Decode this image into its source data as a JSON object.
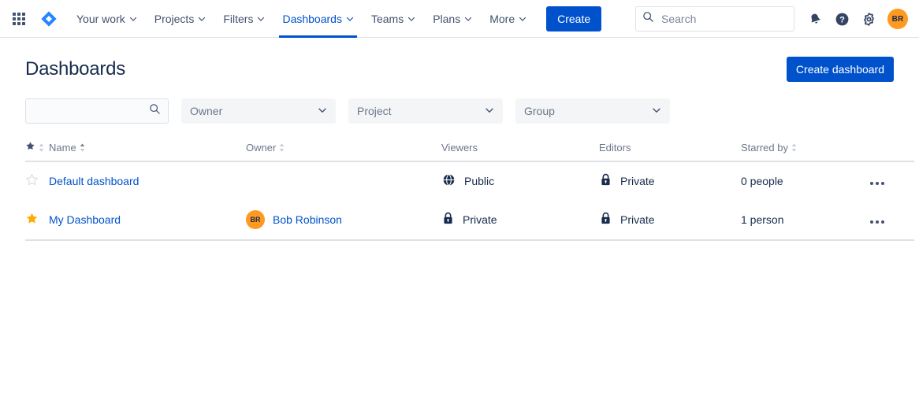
{
  "nav": {
    "app_switcher": "apps-grid-icon",
    "logo": "jira-logo-icon",
    "items": [
      {
        "label": "Your work",
        "has_chevron": true,
        "active": false
      },
      {
        "label": "Projects",
        "has_chevron": true,
        "active": false
      },
      {
        "label": "Filters",
        "has_chevron": true,
        "active": false
      },
      {
        "label": "Dashboards",
        "has_chevron": true,
        "active": true
      },
      {
        "label": "Teams",
        "has_chevron": true,
        "active": false
      },
      {
        "label": "Plans",
        "has_chevron": true,
        "active": false
      },
      {
        "label": "More",
        "has_chevron": true,
        "active": false
      }
    ],
    "create_label": "Create",
    "search": {
      "value": "",
      "placeholder": "Search"
    },
    "notifications_icon": "bell-icon",
    "help_icon": "help-icon",
    "settings_icon": "gear-icon",
    "avatar_initials": "BR"
  },
  "header": {
    "title": "Dashboards",
    "create_dashboard_label": "Create dashboard"
  },
  "filters": {
    "search": {
      "value": "",
      "placeholder": ""
    },
    "owner": {
      "label": "Owner"
    },
    "project": {
      "label": "Project"
    },
    "group": {
      "label": "Group"
    }
  },
  "table": {
    "columns": [
      {
        "key": "star",
        "label": "",
        "sortable": true
      },
      {
        "key": "name",
        "label": "Name",
        "sortable": true,
        "sort": "asc"
      },
      {
        "key": "owner",
        "label": "Owner",
        "sortable": true
      },
      {
        "key": "viewers",
        "label": "Viewers",
        "sortable": false
      },
      {
        "key": "editors",
        "label": "Editors",
        "sortable": false
      },
      {
        "key": "starred_by",
        "label": "Starred by",
        "sortable": true
      },
      {
        "key": "more",
        "label": "",
        "sortable": false
      }
    ],
    "rows": [
      {
        "starred": false,
        "name": "Default dashboard",
        "owner_name": "",
        "owner_initials": "",
        "viewers": "Public",
        "viewers_icon": "globe-icon",
        "editors": "Private",
        "editors_icon": "lock-icon",
        "starred_by": "0 people"
      },
      {
        "starred": true,
        "name": "My Dashboard",
        "owner_name": "Bob Robinson",
        "owner_initials": "BR",
        "viewers": "Private",
        "viewers_icon": "lock-icon",
        "editors": "Private",
        "editors_icon": "lock-icon",
        "starred_by": "1 person"
      }
    ]
  },
  "colors": {
    "brand_blue": "#0052CC",
    "link_blue": "#0052CC",
    "avatar_orange": "#FF991F",
    "star_filled": "#FFAB00",
    "text_dark": "#172B4D",
    "text_subtle": "#6B778C",
    "border": "#DFE1E6"
  }
}
